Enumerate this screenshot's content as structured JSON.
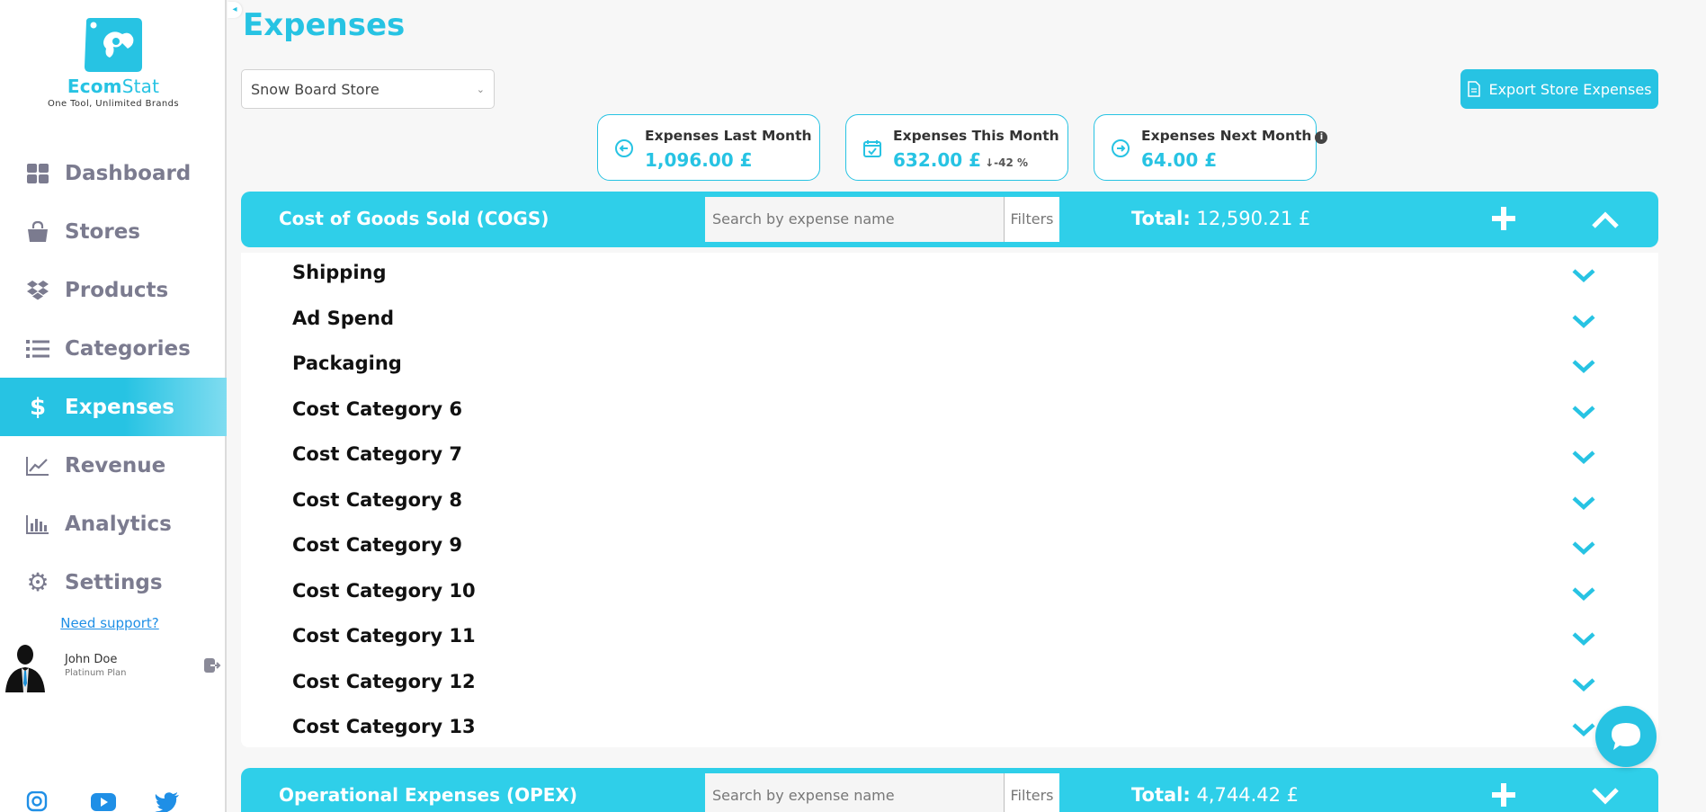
{
  "brand": {
    "name_bold": "Ecom",
    "name_light": "Stat",
    "tagline": "One Tool, Unlimited Brands",
    "accent": "#27c3e3"
  },
  "sidebar": {
    "items": [
      {
        "label": "Dashboard",
        "icon": "grid-icon",
        "active": false
      },
      {
        "label": "Stores",
        "icon": "shopping-bag-icon",
        "active": false
      },
      {
        "label": "Products",
        "icon": "dropbox-icon",
        "active": false
      },
      {
        "label": "Categories",
        "icon": "list-icon",
        "active": false
      },
      {
        "label": "Expenses",
        "icon": "dollar-icon",
        "active": true
      },
      {
        "label": "Revenue",
        "icon": "trend-chart-icon",
        "active": false
      },
      {
        "label": "Analytics",
        "icon": "bar-chart-icon",
        "active": false
      },
      {
        "label": "Settings",
        "icon": "gear-icon",
        "active": false
      }
    ],
    "support_link": "Need support?",
    "user": {
      "name": "John Doe",
      "plan": "Platinum Plan"
    },
    "socials": [
      "instagram-icon",
      "youtube-icon",
      "twitter-icon"
    ]
  },
  "page": {
    "title": "Expenses",
    "store_select": {
      "selected": "Snow Board Store"
    },
    "export_label": "Export Store Expenses"
  },
  "stats": [
    {
      "label": "Expenses Last Month",
      "value": "1,096.00 £",
      "icon": "arrow-left-circle-icon",
      "delta": "",
      "info": false
    },
    {
      "label": "Expenses This Month",
      "value": "632.00 £",
      "icon": "calendar-check-icon",
      "delta": "-42 %",
      "info": false
    },
    {
      "label": "Expenses Next Month",
      "value": "64.00 £",
      "icon": "arrow-right-circle-icon",
      "delta": "",
      "info": true
    }
  ],
  "sections": [
    {
      "title": "Cost of Goods Sold (COGS)",
      "search_placeholder": "Search by expense name",
      "filters_label": "Filters",
      "total_label": "Total:",
      "total_value": "12,590.21  £",
      "expanded": true,
      "rows": [
        "Shipping",
        "Ad Spend",
        "Packaging",
        "Cost Category 6",
        "Cost Category 7",
        "Cost Category 8",
        "Cost Category 9",
        "Cost Category 10",
        "Cost Category 11",
        "Cost Category 12",
        "Cost Category 13"
      ]
    },
    {
      "title": "Operational Expenses (OPEX)",
      "search_placeholder": "Search by expense name",
      "filters_label": "Filters",
      "total_label": "Total:",
      "total_value": "4,744.42 £",
      "expanded": false,
      "rows": []
    }
  ]
}
